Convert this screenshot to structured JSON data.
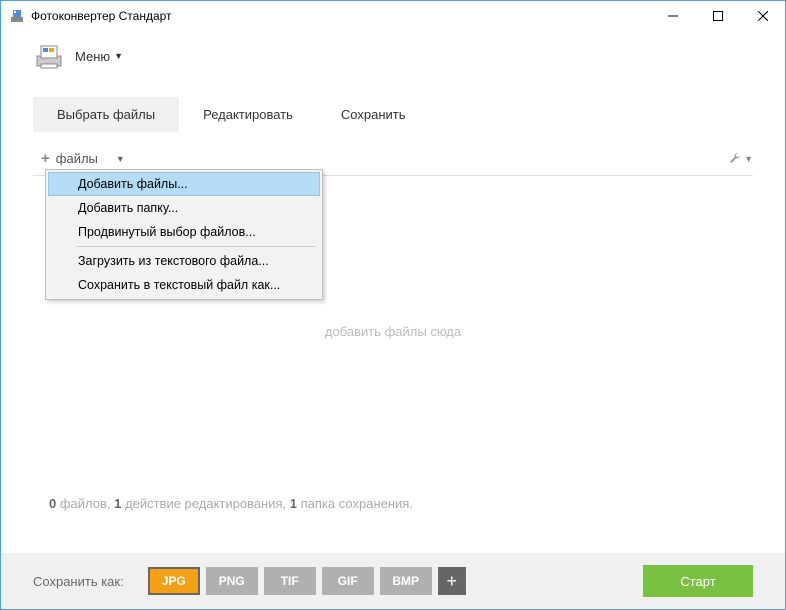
{
  "titlebar": {
    "title": "Фотоконвертер Стандарт"
  },
  "menubar": {
    "label": "Меню"
  },
  "tabs": {
    "items": [
      {
        "label": "Выбрать файлы",
        "active": true
      },
      {
        "label": "Редактировать",
        "active": false
      },
      {
        "label": "Сохранить",
        "active": false
      }
    ]
  },
  "toolbar": {
    "add_files_label": "файлы"
  },
  "dropdown": {
    "items": [
      {
        "label": "Добавить файлы...",
        "highlighted": true
      },
      {
        "label": "Добавить папку...",
        "highlighted": false
      },
      {
        "label": "Продвинутый выбор файлов...",
        "highlighted": false
      }
    ],
    "items2": [
      {
        "label": "Загрузить из текстового файла...",
        "highlighted": false
      },
      {
        "label": "Сохранить в текстовый файл как...",
        "highlighted": false
      }
    ]
  },
  "main": {
    "placeholder": "добавить файлы сюда"
  },
  "status": {
    "files_count": "0",
    "files_word": "файлов,",
    "actions_count": "1",
    "actions_word": "действие редактирования,",
    "folders_count": "1",
    "folders_word": "папка сохранения."
  },
  "footer": {
    "save_as_label": "Сохранить как:",
    "formats": [
      {
        "label": "JPG",
        "active": true
      },
      {
        "label": "PNG",
        "active": false
      },
      {
        "label": "TIF",
        "active": false
      },
      {
        "label": "GIF",
        "active": false
      },
      {
        "label": "BMP",
        "active": false
      }
    ],
    "start_label": "Старт"
  }
}
